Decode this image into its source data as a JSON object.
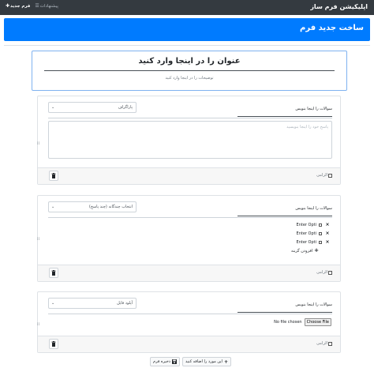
{
  "navbar": {
    "brand": "اپلیکیشن فرم ساز",
    "suggestions": "پیشنهادات",
    "new_form": "فرم جدید",
    "suggestions_icon": "list-icon",
    "new_form_icon": "plus-icon"
  },
  "header": {
    "title": "ساخت جدید فرم"
  },
  "form": {
    "title": "عنوان را در اینجا وارد کنید",
    "description": "توضیحات را در اینجا وارد کنید"
  },
  "questions": [
    {
      "title_placeholder": "سوالات را اینجا بنویس",
      "type": "پاراگراف",
      "answer_placeholder": "پاسخ خود را اینجا بنویسید",
      "required_label": "الزامی",
      "drag_glyph": "⁞⁞"
    },
    {
      "title_placeholder": "سوالات را اینجا بنویس",
      "type": "انتخاب چندگانه (چند پاسخ)",
      "options": [
        "Enter Opti",
        "Enter Opti",
        "Enter Opti"
      ],
      "add_option_label": "افزودن گزینه",
      "required_label": "الزامی",
      "drag_glyph": "⁞⁞"
    },
    {
      "title_placeholder": "سوالات را اینجا بنویس",
      "type": "آپلود فایل",
      "file_status": "No file chosen",
      "file_button": "Choose File",
      "required_label": "الزامی",
      "drag_glyph": "⁞⁞"
    }
  ],
  "actions": {
    "add_item": "این مورد را اضافه کنید",
    "save": "ذخیره فرم"
  },
  "colors": {
    "navbar_bg": "#343a40",
    "primary": "#007bff"
  }
}
